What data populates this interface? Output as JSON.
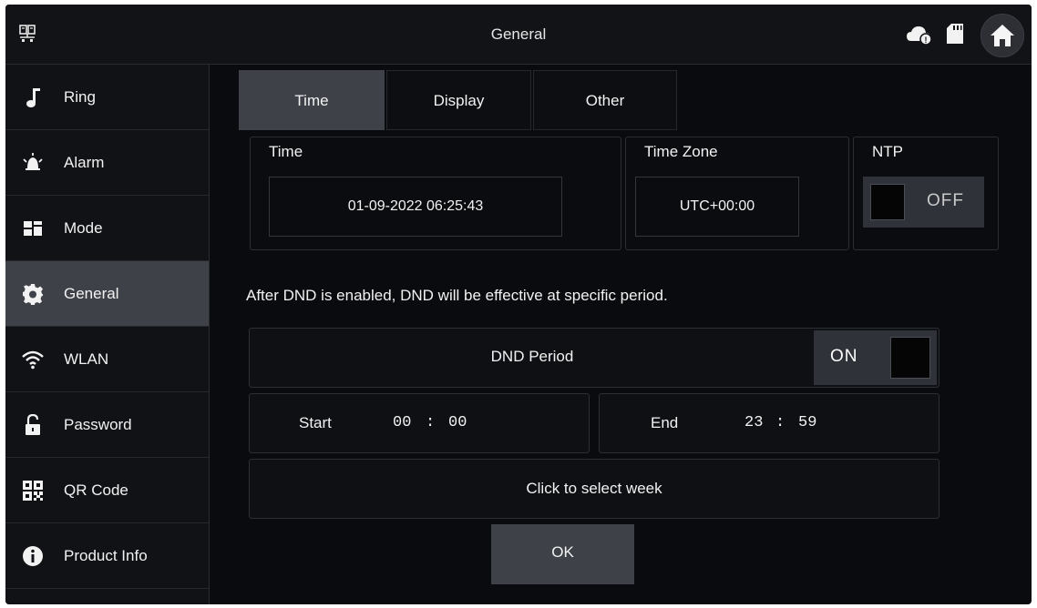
{
  "header": {
    "title": "General",
    "icons": [
      "device-icon",
      "cloud-icon",
      "sd-card-icon",
      "home-icon"
    ]
  },
  "sidebar": {
    "items": [
      {
        "label": "Ring",
        "icon": "music-note-icon"
      },
      {
        "label": "Alarm",
        "icon": "alarm-icon"
      },
      {
        "label": "Mode",
        "icon": "mode-icon"
      },
      {
        "label": "General",
        "icon": "gear-icon",
        "active": true
      },
      {
        "label": "WLAN",
        "icon": "wifi-icon"
      },
      {
        "label": "Password",
        "icon": "lock-icon"
      },
      {
        "label": "QR Code",
        "icon": "qr-code-icon"
      },
      {
        "label": "Product Info",
        "icon": "info-icon"
      }
    ]
  },
  "tabs": [
    {
      "label": "Time",
      "active": true
    },
    {
      "label": "Display"
    },
    {
      "label": "Other"
    }
  ],
  "time": {
    "label": "Time",
    "value": "01-09-2022 06:25:43"
  },
  "timezone": {
    "label": "Time Zone",
    "value": "UTC+00:00"
  },
  "ntp": {
    "label": "NTP",
    "state": "OFF"
  },
  "dnd": {
    "info": "After DND is enabled, DND will be effective at specific period.",
    "period_label": "DND Period",
    "period_state": "ON",
    "start_label": "Start",
    "start_hour": "00",
    "start_minute": "00",
    "end_label": "End",
    "end_hour": "23",
    "end_minute": "59",
    "separator": ":",
    "week_label": "Click to select week"
  },
  "ok_label": "OK",
  "colors": {
    "background": "#0a0b0e",
    "active": "#3e4148",
    "text": "#f2f2f2"
  }
}
